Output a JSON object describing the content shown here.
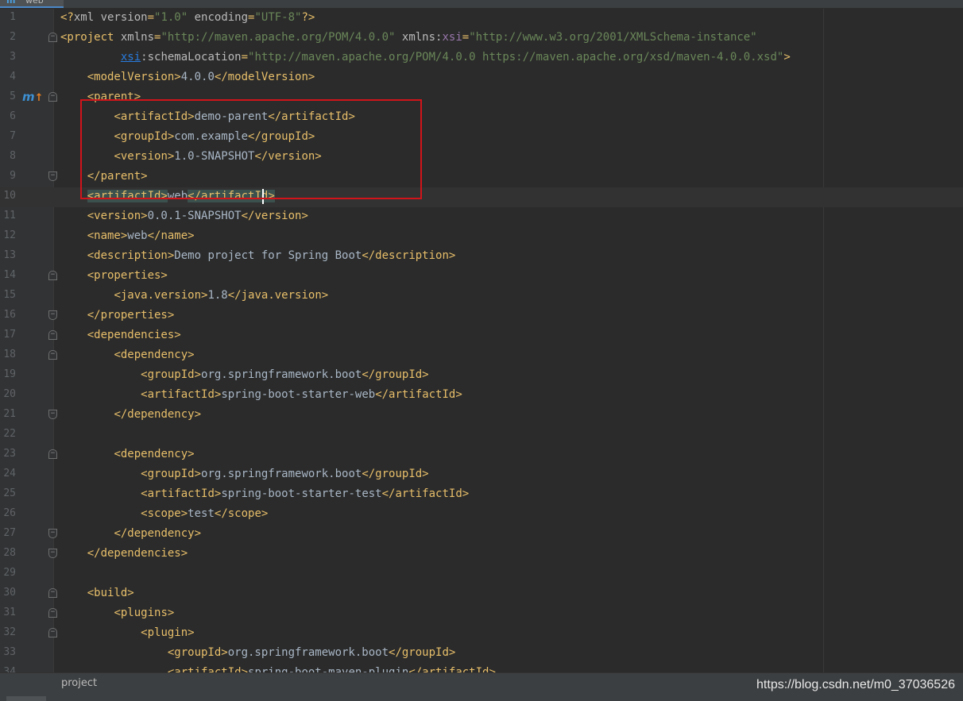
{
  "tab": {
    "icon": "m",
    "label": "web"
  },
  "gutter": {
    "maven_icon_letter": "m",
    "maven_arrow": "↑"
  },
  "lines": [
    {
      "n": "1",
      "fold": "",
      "tokens": [
        [
          "t",
          "<?"
        ],
        [
          "a",
          "xml version"
        ],
        [
          "t",
          "="
        ],
        [
          "v",
          "\"1.0\""
        ],
        [
          "a",
          " encoding"
        ],
        [
          "t",
          "="
        ],
        [
          "v",
          "\"UTF-8\""
        ],
        [
          "t",
          "?>"
        ]
      ]
    },
    {
      "n": "2",
      "fold": "start",
      "tokens": [
        [
          "t",
          "<project"
        ],
        [
          "a",
          " xmlns"
        ],
        [
          "t",
          "="
        ],
        [
          "v",
          "\"http://maven.apache.org/POM/4.0.0\""
        ],
        [
          "a",
          " xmlns:"
        ],
        [
          "n",
          "xsi"
        ],
        [
          "t",
          "="
        ],
        [
          "v",
          "\"http://www.w3.org/2001/XMLSchema-instance\""
        ]
      ]
    },
    {
      "n": "3",
      "fold": "",
      "tokens": [
        [
          "x",
          "         "
        ],
        [
          "l",
          "xsi"
        ],
        [
          "a",
          ":schemaLocation"
        ],
        [
          "t",
          "="
        ],
        [
          "v",
          "\"http://maven.apache.org/POM/4.0.0 https://maven.apache.org/xsd/maven-4.0.0.xsd\""
        ],
        [
          "t",
          ">"
        ]
      ]
    },
    {
      "n": "4",
      "fold": "",
      "tokens": [
        [
          "x",
          "    "
        ],
        [
          "t",
          "<modelVersion>"
        ],
        [
          "x",
          "4.0.0"
        ],
        [
          "t",
          "</modelVersion>"
        ]
      ]
    },
    {
      "n": "5",
      "fold": "start",
      "maven": true,
      "tokens": [
        [
          "x",
          "    "
        ],
        [
          "t",
          "<parent>"
        ]
      ]
    },
    {
      "n": "6",
      "fold": "",
      "tokens": [
        [
          "x",
          "        "
        ],
        [
          "t",
          "<artifactId>"
        ],
        [
          "x",
          "demo-parent"
        ],
        [
          "t",
          "</artifactId>"
        ]
      ]
    },
    {
      "n": "7",
      "fold": "",
      "tokens": [
        [
          "x",
          "        "
        ],
        [
          "t",
          "<groupId>"
        ],
        [
          "x",
          "com.example"
        ],
        [
          "t",
          "</groupId>"
        ]
      ]
    },
    {
      "n": "8",
      "fold": "",
      "tokens": [
        [
          "x",
          "        "
        ],
        [
          "t",
          "<version>"
        ],
        [
          "x",
          "1.0-SNAPSHOT"
        ],
        [
          "t",
          "</version>"
        ]
      ]
    },
    {
      "n": "9",
      "fold": "end",
      "tokens": [
        [
          "x",
          "    "
        ],
        [
          "t",
          "</parent>"
        ]
      ]
    },
    {
      "n": "10",
      "fold": "",
      "current": true,
      "tokens": [
        [
          "x",
          "    "
        ],
        [
          "h",
          "<artifactId>"
        ],
        [
          "x",
          "web"
        ],
        [
          "h",
          "</artifactId>"
        ]
      ]
    },
    {
      "n": "11",
      "fold": "",
      "tokens": [
        [
          "x",
          "    "
        ],
        [
          "t",
          "<version>"
        ],
        [
          "x",
          "0.0.1-SNAPSHOT"
        ],
        [
          "t",
          "</version>"
        ]
      ]
    },
    {
      "n": "12",
      "fold": "",
      "tokens": [
        [
          "x",
          "    "
        ],
        [
          "t",
          "<name>"
        ],
        [
          "x",
          "web"
        ],
        [
          "t",
          "</name>"
        ]
      ]
    },
    {
      "n": "13",
      "fold": "",
      "tokens": [
        [
          "x",
          "    "
        ],
        [
          "t",
          "<description>"
        ],
        [
          "x",
          "Demo project for Spring Boot"
        ],
        [
          "t",
          "</description>"
        ]
      ]
    },
    {
      "n": "14",
      "fold": "start",
      "tokens": [
        [
          "x",
          "    "
        ],
        [
          "t",
          "<properties>"
        ]
      ]
    },
    {
      "n": "15",
      "fold": "",
      "tokens": [
        [
          "x",
          "        "
        ],
        [
          "t",
          "<java.version>"
        ],
        [
          "x",
          "1.8"
        ],
        [
          "t",
          "</java.version>"
        ]
      ]
    },
    {
      "n": "16",
      "fold": "end",
      "tokens": [
        [
          "x",
          "    "
        ],
        [
          "t",
          "</properties>"
        ]
      ]
    },
    {
      "n": "17",
      "fold": "start",
      "tokens": [
        [
          "x",
          "    "
        ],
        [
          "t",
          "<dependencies>"
        ]
      ]
    },
    {
      "n": "18",
      "fold": "start",
      "tokens": [
        [
          "x",
          "        "
        ],
        [
          "t",
          "<dependency>"
        ]
      ]
    },
    {
      "n": "19",
      "fold": "",
      "tokens": [
        [
          "x",
          "            "
        ],
        [
          "t",
          "<groupId>"
        ],
        [
          "x",
          "org.springframework.boot"
        ],
        [
          "t",
          "</groupId>"
        ]
      ]
    },
    {
      "n": "20",
      "fold": "",
      "tokens": [
        [
          "x",
          "            "
        ],
        [
          "t",
          "<artifactId>"
        ],
        [
          "x",
          "spring-boot-starter-web"
        ],
        [
          "t",
          "</artifactId>"
        ]
      ]
    },
    {
      "n": "21",
      "fold": "end",
      "tokens": [
        [
          "x",
          "        "
        ],
        [
          "t",
          "</dependency>"
        ]
      ]
    },
    {
      "n": "22",
      "fold": "",
      "tokens": []
    },
    {
      "n": "23",
      "fold": "start",
      "tokens": [
        [
          "x",
          "        "
        ],
        [
          "t",
          "<dependency>"
        ]
      ]
    },
    {
      "n": "24",
      "fold": "",
      "tokens": [
        [
          "x",
          "            "
        ],
        [
          "t",
          "<groupId>"
        ],
        [
          "x",
          "org.springframework.boot"
        ],
        [
          "t",
          "</groupId>"
        ]
      ]
    },
    {
      "n": "25",
      "fold": "",
      "tokens": [
        [
          "x",
          "            "
        ],
        [
          "t",
          "<artifactId>"
        ],
        [
          "x",
          "spring-boot-starter-test"
        ],
        [
          "t",
          "</artifactId>"
        ]
      ]
    },
    {
      "n": "26",
      "fold": "",
      "tokens": [
        [
          "x",
          "            "
        ],
        [
          "t",
          "<scope>"
        ],
        [
          "x",
          "test"
        ],
        [
          "t",
          "</scope>"
        ]
      ]
    },
    {
      "n": "27",
      "fold": "end",
      "tokens": [
        [
          "x",
          "        "
        ],
        [
          "t",
          "</dependency>"
        ]
      ]
    },
    {
      "n": "28",
      "fold": "end",
      "tokens": [
        [
          "x",
          "    "
        ],
        [
          "t",
          "</dependencies>"
        ]
      ]
    },
    {
      "n": "29",
      "fold": "",
      "tokens": []
    },
    {
      "n": "30",
      "fold": "start",
      "tokens": [
        [
          "x",
          "    "
        ],
        [
          "t",
          "<build>"
        ]
      ]
    },
    {
      "n": "31",
      "fold": "start",
      "tokens": [
        [
          "x",
          "        "
        ],
        [
          "t",
          "<plugins>"
        ]
      ]
    },
    {
      "n": "32",
      "fold": "start",
      "tokens": [
        [
          "x",
          "            "
        ],
        [
          "t",
          "<plugin>"
        ]
      ]
    },
    {
      "n": "33",
      "fold": "",
      "tokens": [
        [
          "x",
          "                "
        ],
        [
          "t",
          "<groupId>"
        ],
        [
          "x",
          "org.springframework.boot"
        ],
        [
          "t",
          "</groupId>"
        ]
      ]
    },
    {
      "n": "34",
      "fold": "",
      "tokens": [
        [
          "x",
          "                "
        ],
        [
          "t",
          "<artifactId>"
        ],
        [
          "x",
          "spring-boot-maven-plugin"
        ],
        [
          "t",
          "</artifactId>"
        ]
      ]
    }
  ],
  "statusbar": {
    "breadcrumb": "project"
  },
  "watermark": "https://blog.csdn.net/m0_37036526"
}
